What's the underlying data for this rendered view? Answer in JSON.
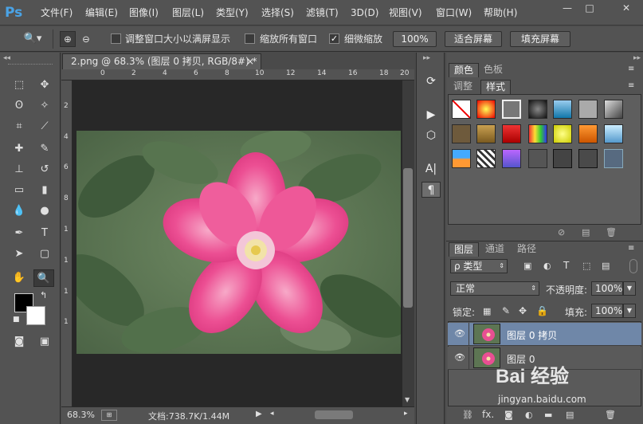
{
  "app": {
    "logo": "Ps"
  },
  "menu": [
    "文件(F)",
    "编辑(E)",
    "图像(I)",
    "图层(L)",
    "类型(Y)",
    "选择(S)",
    "滤镜(T)",
    "3D(D)",
    "视图(V)",
    "窗口(W)",
    "帮助(H)"
  ],
  "window_controls": {
    "minimize": "—",
    "restore": "□",
    "close": "✕"
  },
  "options": {
    "resize_windows": "调整窗口大小以满屏显示",
    "zoom_all": "缩放所有窗口",
    "scrubby_zoom": "细微缩放",
    "scrubby_checked": true,
    "pct_button": "100%",
    "fit_screen": "适合屏幕",
    "fill_screen": "填充屏幕"
  },
  "document": {
    "tab_title": "2.png @ 68.3% (图层 0 拷贝, RGB/8#) *",
    "close": "×",
    "h_ruler": [
      "0",
      "2",
      "4",
      "6",
      "8",
      "10",
      "12",
      "14",
      "16",
      "18",
      "20"
    ],
    "v_ruler": [
      "2",
      "4",
      "6",
      "8",
      "1",
      "1",
      "1",
      "1"
    ],
    "zoom": "68.3%",
    "doc_size": "文档:738.7K/1.44M"
  },
  "color_panel": {
    "tabs": [
      "颜色",
      "色板"
    ]
  },
  "styles_panel": {
    "tabs": [
      "调整",
      "样式"
    ]
  },
  "layers_panel": {
    "tabs": [
      "图层",
      "通道",
      "路径"
    ],
    "filter": "ρ 类型",
    "blend_mode": "正常",
    "opacity_label": "不透明度:",
    "opacity": "100%",
    "lock_label": "锁定:",
    "fill_label": "填充:",
    "fill": "100%",
    "layers": [
      {
        "name": "图层 0 拷贝",
        "selected": true
      },
      {
        "name": "图层 0",
        "selected": false
      }
    ]
  },
  "watermark": {
    "text": "Bai 经验",
    "url": "jingyan.baidu.com"
  },
  "colors": {
    "accent": "#4aa3e6",
    "selected_layer": "#6f87a8"
  }
}
